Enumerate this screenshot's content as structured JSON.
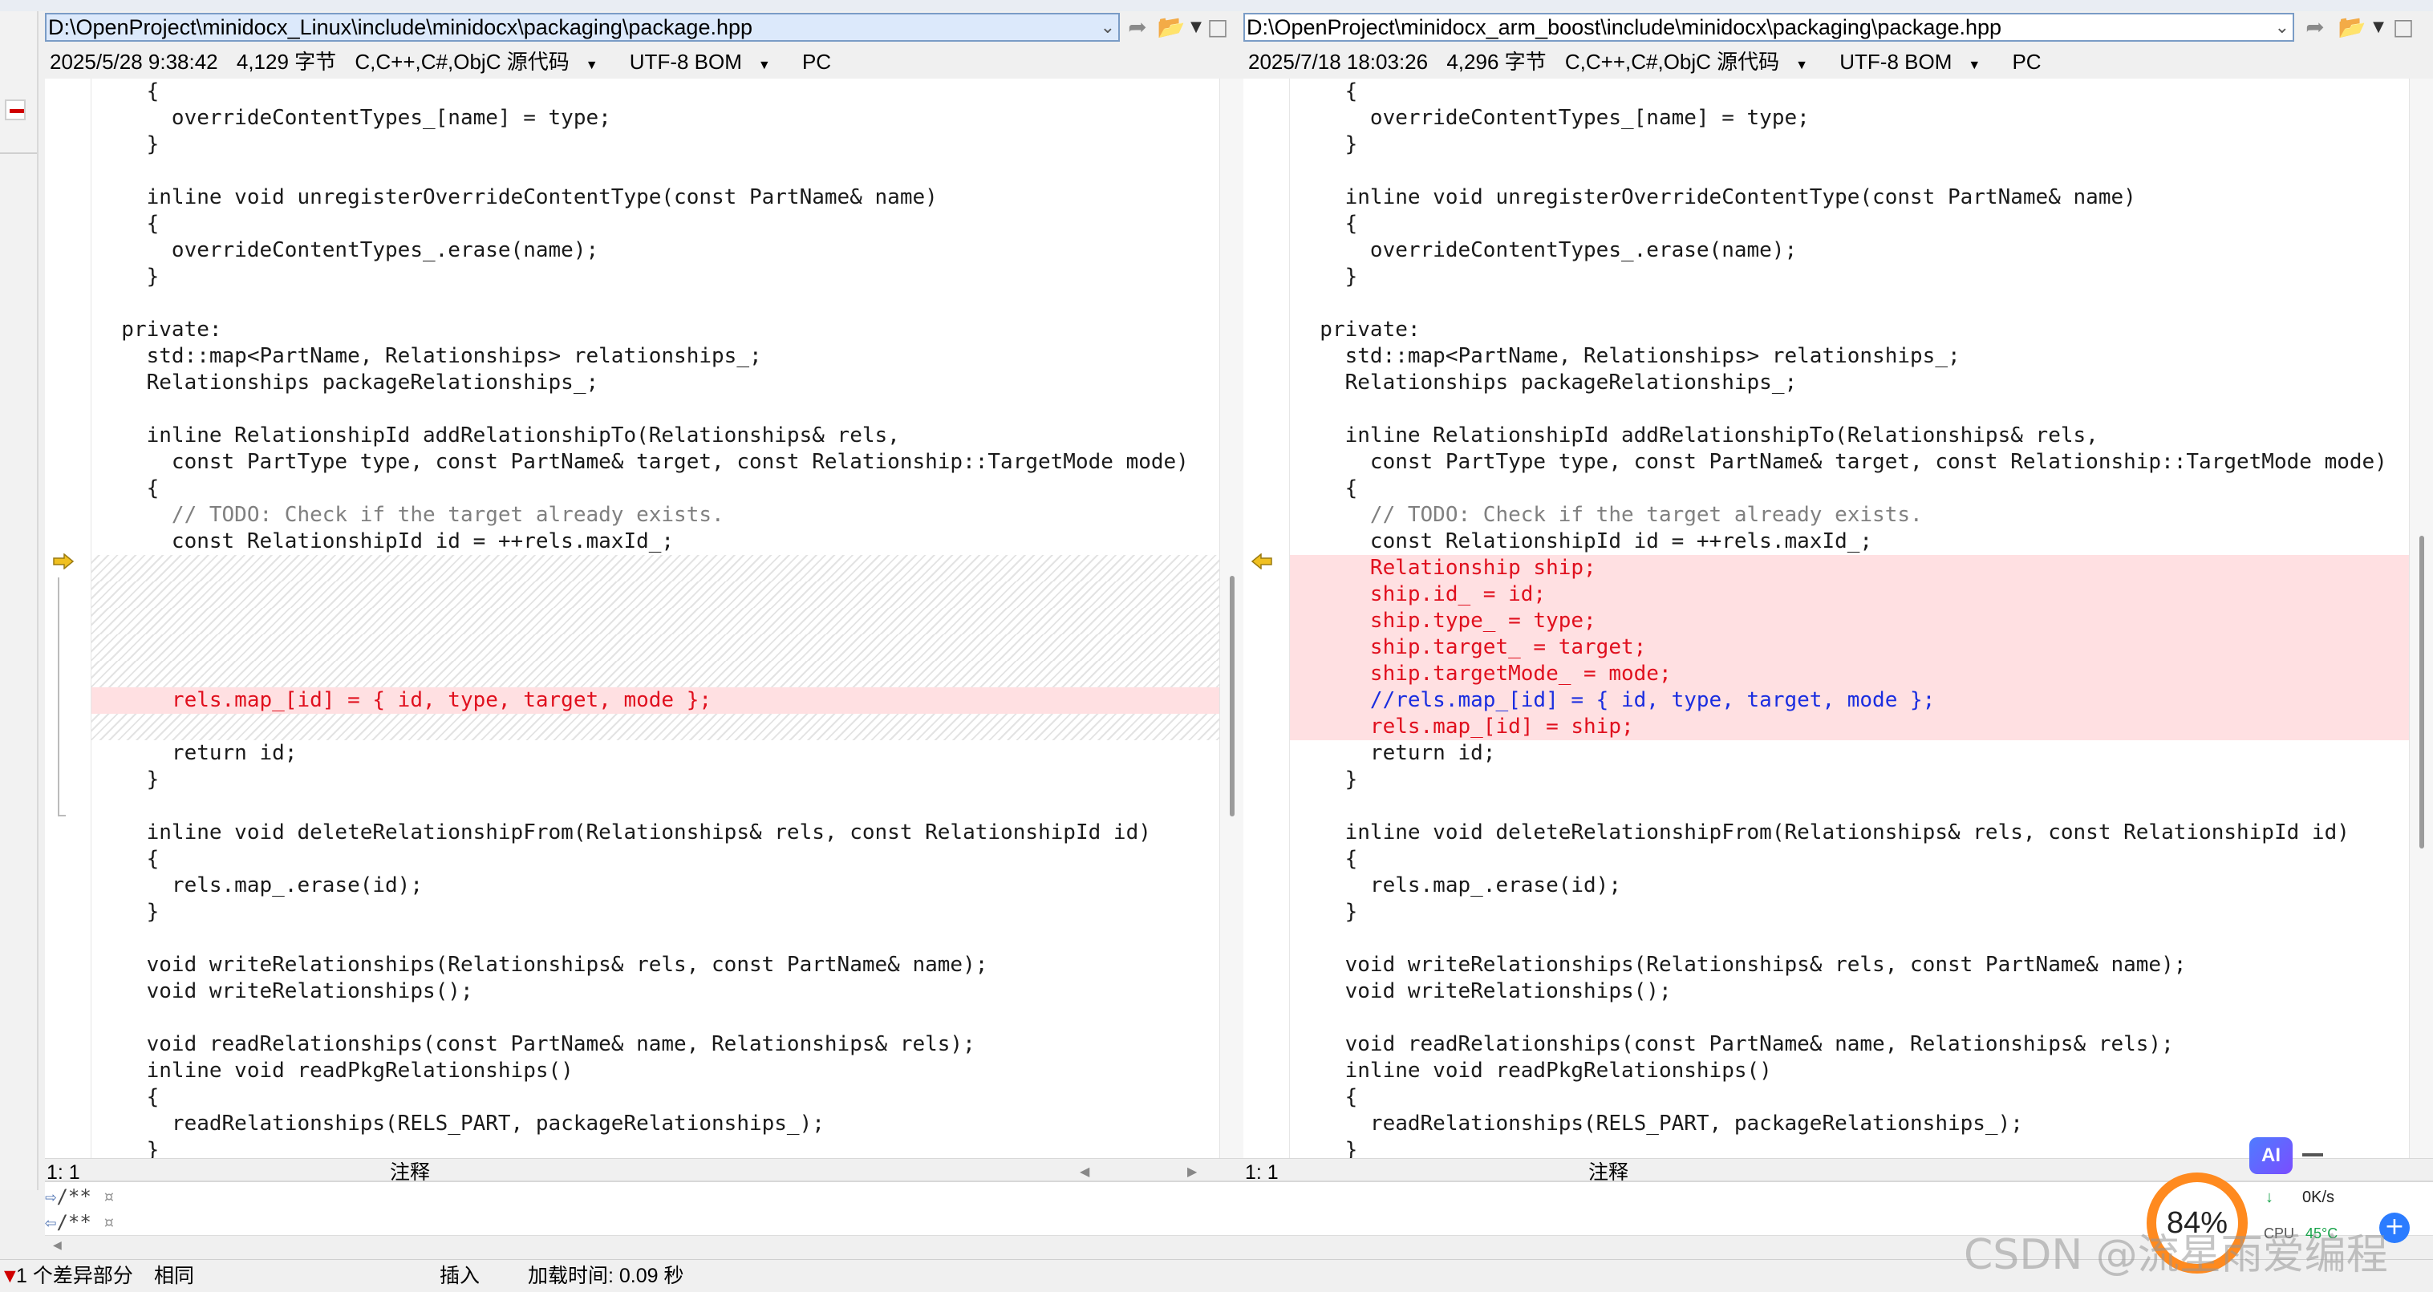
{
  "left": {
    "path": "D:\\OpenProject\\minidocx_Linux\\include\\minidocx\\packaging\\package.hpp",
    "timestamp": "2025/5/28 9:38:42",
    "size": "4,129 字节",
    "language": "C,C++,C#,ObjC 源代码",
    "encoding": "UTF-8 BOM",
    "lineend": "PC",
    "cursor": "1: 1",
    "mode": "注释"
  },
  "right": {
    "path": "D:\\OpenProject\\minidocx_arm_boost\\include\\minidocx\\packaging\\package.hpp",
    "timestamp": "2025/7/18 18:03:26",
    "size": "4,296 字节",
    "language": "C,C++,C#,ObjC 源代码",
    "encoding": "UTF-8 BOM",
    "lineend": "PC",
    "cursor": "1: 1",
    "mode": "注释"
  },
  "code": {
    "before": [
      "    {",
      "      overrideContentTypes_[name] = type;",
      "    }",
      "",
      "    inline void unregisterOverrideContentType(const PartName& name)",
      "    {",
      "      overrideContentTypes_.erase(name);",
      "    }",
      "",
      "  private:",
      "    std::map<PartName, Relationships> relationships_;",
      "    Relationships packageRelationships_;",
      "",
      "    inline RelationshipId addRelationshipTo(Relationships& rels,",
      "      const PartType type, const PartName& target, const Relationship::TargetMode mode)",
      "    {",
      "      // TODO: Check if the target already exists.",
      "      const RelationshipId id = ++rels.maxId_;"
    ],
    "left_diff": [
      "",
      "",
      "",
      "",
      "",
      "      rels.map_[id] = { id, type, target, mode };",
      ""
    ],
    "right_diff": [
      "      Relationship ship;",
      "      ship.id_ = id;",
      "      ship.type_ = type;",
      "      ship.target_ = target;",
      "      ship.targetMode_ = mode;",
      "      //rels.map_[id] = { id, type, target, mode };",
      "      rels.map_[id] = ship;"
    ],
    "after": [
      "      return id;",
      "    }",
      "",
      "    inline void deleteRelationshipFrom(Relationships& rels, const RelationshipId id)",
      "    {",
      "      rels.map_.erase(id);",
      "    }",
      "",
      "    void writeRelationships(Relationships& rels, const PartName& name);",
      "    void writeRelationships();",
      "",
      "    void readRelationships(const PartName& name, Relationships& rels);",
      "    inline void readPkgRelationships()",
      "    {",
      "      readRelationships(RELS_PART, packageRelationships_);",
      "    }"
    ]
  },
  "compare": {
    "line1": "/**",
    "line2": "/**"
  },
  "status": {
    "diff_count": "1 个差异部分",
    "same": "相同",
    "insert": "插入",
    "load_time": "加载时间:  0.09 秒"
  },
  "overlay": {
    "ai_label": "AI",
    "perf_percent": "84%",
    "net_up": "0K/s",
    "cpu_label": "CPU",
    "temp": "45°C",
    "watermark": "CSDN @流星雨爱编程"
  },
  "colors": {
    "diff_bg": "#ffe0e2",
    "diff_text": "#e0101e",
    "diff_comment": "#1a2de0",
    "comment": "#808080",
    "marker": "#f0c020"
  },
  "icons": [
    "dropdown-icon",
    "next-file-icon",
    "open-folder-icon",
    "save-icon",
    "diff-arrow-right-icon",
    "diff-arrow-left-icon"
  ]
}
